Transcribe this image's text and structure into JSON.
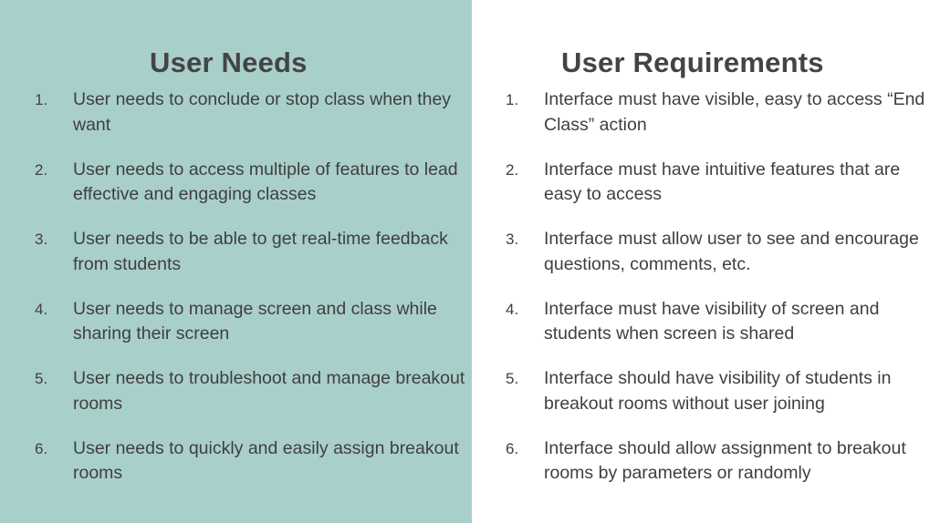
{
  "left": {
    "title": "User Needs",
    "items": [
      {
        "num": "1.",
        "text": "User needs to conclude or stop class when they want"
      },
      {
        "num": "2.",
        "text": "User needs to access multiple of features to lead effective and engaging classes"
      },
      {
        "num": "3.",
        "text": "User needs to be able to get real-time feedback from students"
      },
      {
        "num": "4.",
        "text": "User needs to manage screen and class while sharing their screen"
      },
      {
        "num": "5.",
        "text": "User needs to troubleshoot and manage breakout rooms"
      },
      {
        "num": "6.",
        "text": "User needs to quickly and easily assign breakout rooms"
      }
    ]
  },
  "right": {
    "title": "User Requirements",
    "items": [
      {
        "num": "1.",
        "text": "Interface must have visible, easy to access “End Class” action"
      },
      {
        "num": "2.",
        "text": "Interface must have intuitive features that are easy to access"
      },
      {
        "num": "3.",
        "text": "Interface must allow user to see and encourage questions, comments, etc."
      },
      {
        "num": "4.",
        "text": "Interface must have visibility of screen and students when screen is shared"
      },
      {
        "num": "5.",
        "text": "Interface should have visibility of students in breakout rooms without user joining"
      },
      {
        "num": "6.",
        "text": "Interface should allow assignment to breakout rooms by parameters or randomly"
      }
    ]
  },
  "colors": {
    "left_panel_bg": "#a9cfcb",
    "right_panel_bg": "#ffffff",
    "text": "#3f3f3f"
  }
}
